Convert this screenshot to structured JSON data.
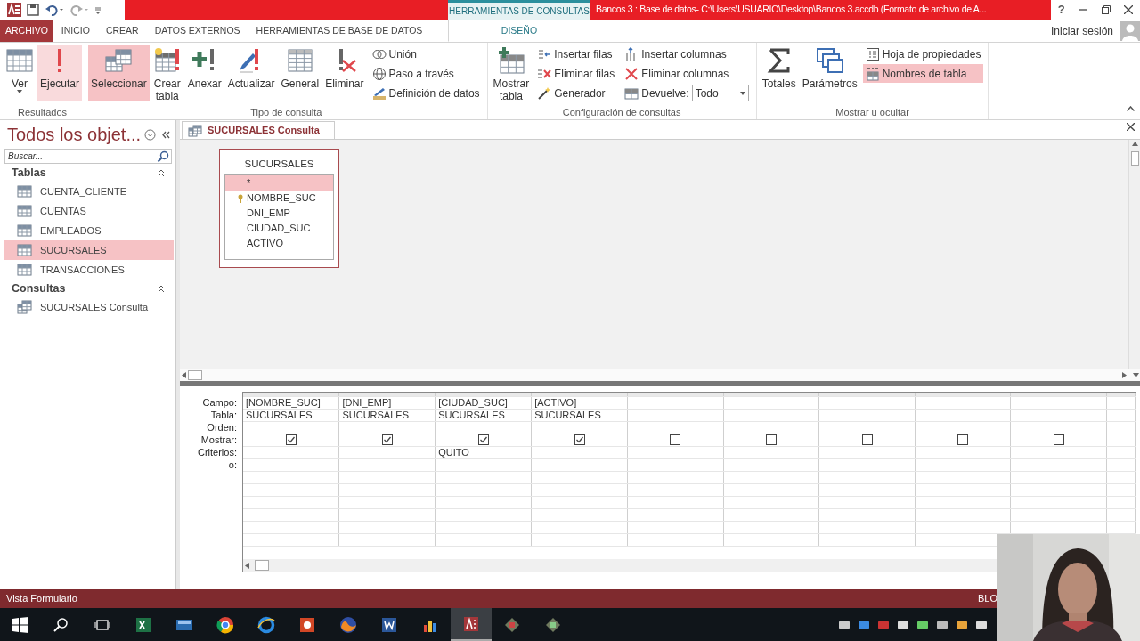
{
  "title_bar": {
    "context_label": "HERRAMIENTAS DE CONSULTAS",
    "title": "Bancos 3 : Base de datos- C:\\Users\\USUARIO\\Desktop\\Bancos 3.accdb (Formato de archivo de A...",
    "help": "?"
  },
  "ribbon_tabs": [
    {
      "label": "ARCHIVO",
      "kind": "file",
      "selected": false
    },
    {
      "label": "INICIO",
      "kind": "tab",
      "selected": false
    },
    {
      "label": "CREAR",
      "kind": "tab",
      "selected": false
    },
    {
      "label": "DATOS EXTERNOS",
      "kind": "tab",
      "selected": false
    },
    {
      "label": "HERRAMIENTAS DE BASE DE DATOS",
      "kind": "tab",
      "selected": false
    },
    {
      "label": "DISEÑO",
      "kind": "context",
      "selected": true
    }
  ],
  "sign_in": "Iniciar sesión",
  "ribbon_groups": [
    {
      "label": "Resultados",
      "items": [
        {
          "kind": "large",
          "label": "Ver",
          "dropdown": true,
          "selected": false,
          "hovered": false
        },
        {
          "kind": "large",
          "label": "Ejecutar",
          "selected": false,
          "hovered": true
        }
      ]
    },
    {
      "label": "Tipo de consulta",
      "items": [
        {
          "kind": "large",
          "label": "Seleccionar",
          "selected": true,
          "hovered": false
        },
        {
          "kind": "large",
          "label": "Crear tabla",
          "selected": false,
          "hovered": false
        },
        {
          "kind": "large",
          "label": "Anexar",
          "selected": false,
          "hovered": false
        },
        {
          "kind": "large",
          "label": "Actualizar",
          "selected": false,
          "hovered": false
        },
        {
          "kind": "large",
          "label": "General",
          "selected": false,
          "hovered": false
        },
        {
          "kind": "large",
          "label": "Eliminar",
          "selected": false,
          "hovered": false
        },
        {
          "kind": "small",
          "label": "Unión",
          "selected": false
        },
        {
          "kind": "small",
          "label": "Paso a través",
          "selected": false
        },
        {
          "kind": "small",
          "label": "Definición de datos",
          "selected": false
        }
      ]
    },
    {
      "label": "Configuración de consultas",
      "items": [
        {
          "kind": "large",
          "label": "Mostrar tabla",
          "selected": false,
          "hovered": false
        },
        {
          "kind": "small",
          "label": "Insertar filas",
          "selected": false
        },
        {
          "kind": "small",
          "label": "Eliminar filas",
          "selected": false
        },
        {
          "kind": "small",
          "label": "Generador",
          "selected": false
        },
        {
          "kind": "small",
          "label": "Insertar columnas",
          "selected": false
        },
        {
          "kind": "small",
          "label": "Eliminar columnas",
          "selected": false
        },
        {
          "kind": "combo",
          "label": "Devuelve:",
          "value": "Todo"
        }
      ]
    },
    {
      "label": "Mostrar u ocultar",
      "items": [
        {
          "kind": "large",
          "label": "Totales",
          "selected": false,
          "hovered": false
        },
        {
          "kind": "large",
          "label": "Parámetros",
          "selected": false,
          "hovered": false
        },
        {
          "kind": "small",
          "label": "Hoja de propiedades",
          "selected": false
        },
        {
          "kind": "small",
          "label": "Nombres de tabla",
          "selected": true
        }
      ]
    }
  ],
  "nav_pane": {
    "title": "Todos los objet...",
    "search_placeholder": "Buscar...",
    "groups": [
      {
        "label": "Tablas",
        "kind": "table",
        "items": [
          {
            "label": "CUENTA_CLIENTE",
            "selected": false
          },
          {
            "label": "CUENTAS",
            "selected": false
          },
          {
            "label": "EMPLEADOS",
            "selected": false
          },
          {
            "label": "SUCURSALES",
            "selected": true
          },
          {
            "label": "TRANSACCIONES",
            "selected": false
          }
        ]
      },
      {
        "label": "Consultas",
        "kind": "query",
        "items": [
          {
            "label": "SUCURSALES Consulta",
            "selected": false
          }
        ]
      }
    ]
  },
  "document_tab": {
    "label": "SUCURSALES Consulta"
  },
  "field_list": {
    "title": "SUCURSALES",
    "fields": [
      {
        "label": "*",
        "selected": true,
        "primary_key": false
      },
      {
        "label": "NOMBRE_SUC",
        "selected": false,
        "primary_key": true
      },
      {
        "label": "DNI_EMP",
        "selected": false,
        "primary_key": false
      },
      {
        "label": "CIUDAD_SUC",
        "selected": false,
        "primary_key": false
      },
      {
        "label": "ACTIVO",
        "selected": false,
        "primary_key": false
      }
    ]
  },
  "design_grid": {
    "row_labels": [
      "Campo:",
      "Tabla:",
      "Orden:",
      "Mostrar:",
      "Criterios:",
      "o:"
    ],
    "columns": [
      {
        "field": "[NOMBRE_SUC]",
        "table": "SUCURSALES",
        "show": true
      },
      {
        "field": "[DNI_EMP]",
        "table": "SUCURSALES",
        "show": true
      },
      {
        "field": "[CIUDAD_SUC]",
        "table": "SUCURSALES",
        "show": true,
        "criteria": "QUITO"
      },
      {
        "field": "[ACTIVO]",
        "table": "SUCURSALES",
        "show": true
      },
      {
        "show": false
      },
      {
        "show": false
      },
      {
        "show": false
      },
      {
        "show": false
      },
      {
        "show": false
      }
    ]
  },
  "status_bar": {
    "left": "Vista Formulario",
    "right": "BLO"
  }
}
